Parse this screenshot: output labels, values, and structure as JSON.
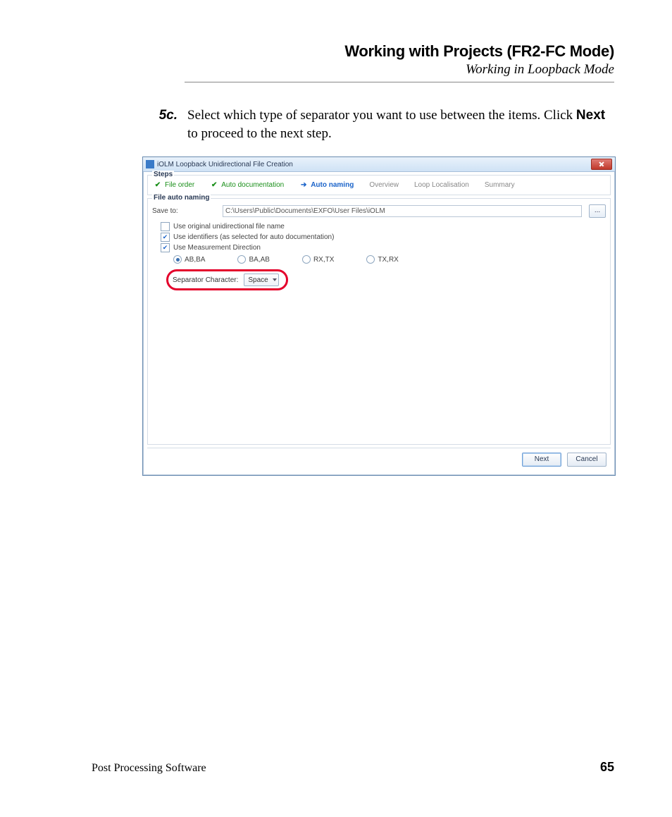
{
  "header": {
    "title": "Working with Projects (FR2-FC Mode)",
    "subtitle": "Working in Loopback Mode"
  },
  "step": {
    "number": "5c.",
    "text_before_bold": "Select which type of separator you want to use between the items. Click ",
    "bold": "Next",
    "text_after_bold": " to proceed to the next step."
  },
  "dialog": {
    "title": "iOLM Loopback Unidirectional File Creation",
    "steps_legend": "Steps",
    "steps": [
      {
        "state": "done",
        "mark": "✔",
        "label": "File order"
      },
      {
        "state": "done",
        "mark": "✔",
        "label": "Auto documentation"
      },
      {
        "state": "current",
        "mark": "➔",
        "label": "Auto naming"
      },
      {
        "state": "future",
        "mark": "",
        "label": "Overview"
      },
      {
        "state": "future",
        "mark": "",
        "label": "Loop Localisation"
      },
      {
        "state": "future",
        "mark": "",
        "label": "Summary"
      }
    ],
    "auto_naming_legend": "File auto naming",
    "save_to_label": "Save to:",
    "save_to_value": "C:\\Users\\Public\\Documents\\EXFO\\User Files\\iOLM",
    "browse_label": "...",
    "checkboxes": {
      "use_original": {
        "checked": false,
        "label": "Use original unidirectional file name"
      },
      "use_identifiers": {
        "checked": true,
        "label": "Use identifiers (as selected for auto documentation)"
      },
      "use_direction": {
        "checked": true,
        "label": "Use Measurement Direction"
      }
    },
    "radios": [
      {
        "checked": true,
        "label": "AB,BA"
      },
      {
        "checked": false,
        "label": "BA,AB"
      },
      {
        "checked": false,
        "label": "RX,TX"
      },
      {
        "checked": false,
        "label": "TX,RX"
      }
    ],
    "separator_label": "Separator Character:",
    "separator_value": "Space",
    "buttons": {
      "next": "Next",
      "cancel": "Cancel"
    }
  },
  "footer": {
    "product": "Post Processing Software",
    "page": "65"
  }
}
